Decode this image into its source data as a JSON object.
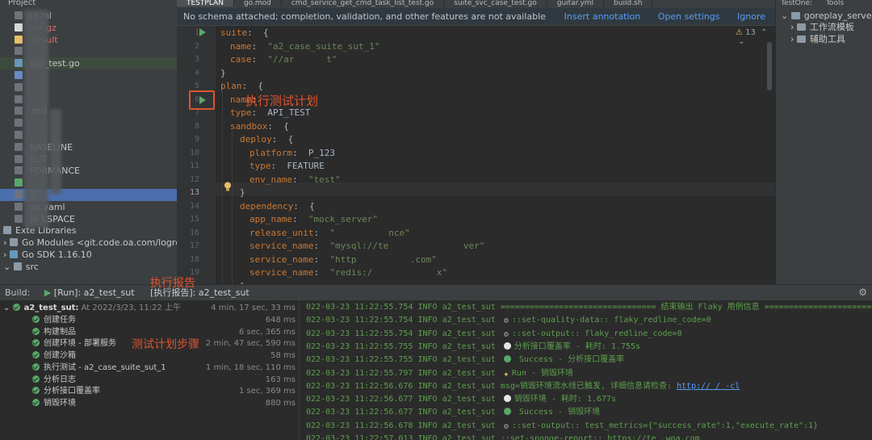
{
  "project": {
    "title": "Project",
    "items": [
      {
        "label": "pa     ml",
        "color": "#a9b7c6"
      },
      {
        "label": "         ser    gz",
        "color": "#e06c6c"
      },
      {
        "label": "           -result",
        "color": "#e06c6c"
      },
      {
        "label": "",
        "color": "#c8c8c8"
      },
      {
        "label": "        tup_test.go",
        "color": "#c8c8c8"
      },
      {
        "label": "",
        "color": "#c8c8c8"
      },
      {
        "label": "",
        "color": "#c8c8c8"
      },
      {
        "label": "",
        "color": "#c8c8c8"
      },
      {
        "label": "          .md",
        "color": "#c8c8c8"
      },
      {
        "label": "",
        "color": "#c8c8c8"
      },
      {
        "label": "",
        "color": "#c8c8c8"
      },
      {
        "label": "         BASELINE",
        "color": "#c8c8c8"
      },
      {
        "label": "         SUT",
        "color": "#c8c8c8"
      },
      {
        "label": "         FORMANCE",
        "color": "#c8c8c8"
      },
      {
        "label": "",
        "color": "#c8c8c8"
      },
      {
        "label": "        A",
        "color": "#c8c8c8"
      },
      {
        "label": "        go.yaml",
        "color": "#c8c8c8"
      },
      {
        "label": "  W    KSPACE",
        "color": "#c8c8c8"
      },
      {
        "label": "Exte   Libraries",
        "color": "#c8c8c8"
      },
      {
        "label": "Go Modules <git.code.oa.com/logreplay/",
        "color": "#c8c8c8"
      },
      {
        "label": "Go SDK 1.16.10",
        "color": "#c8c8c8"
      },
      {
        "label": "src",
        "color": "#c8c8c8"
      }
    ]
  },
  "editor": {
    "tabs": [
      "TESTPLAN",
      "go.mod",
      "cmd_service_get_cmd_task_list_test.go",
      "suite_svc_case_test.go",
      "guitar.yml",
      "build.sh"
    ],
    "banner": {
      "message": "No schema attached; completion, validation, and other features are not available",
      "insert": "Insert annotation",
      "settings": "Open settings",
      "ignore": "Ignore"
    },
    "warning_count": "13",
    "annotation": "执行测试计划",
    "lines": [
      {
        "n": "1",
        "indent": 0,
        "key": "suite",
        "val": "",
        "tail": "{"
      },
      {
        "n": "2",
        "indent": 1,
        "key": "name",
        "val": "\"a2_case_suite_sut_1\"",
        "tail": ""
      },
      {
        "n": "3",
        "indent": 1,
        "key": "case",
        "val": "\"//ar      t\"",
        "tail": ""
      },
      {
        "n": "4",
        "indent": 0,
        "key": "",
        "val": "",
        "tail": "}"
      },
      {
        "n": "5",
        "indent": 0,
        "key": "plan",
        "val": "",
        "tail": "{"
      },
      {
        "n": "6",
        "indent": 1,
        "key": "name",
        "val": "",
        "tail": ""
      },
      {
        "n": "7",
        "indent": 1,
        "key": "type",
        "val": "API_TEST",
        "tail": ""
      },
      {
        "n": "8",
        "indent": 1,
        "key": "sandbox",
        "val": "",
        "tail": "{"
      },
      {
        "n": "9",
        "indent": 2,
        "key": "deploy",
        "val": "",
        "tail": "{"
      },
      {
        "n": "10",
        "indent": 3,
        "key": "platform",
        "val": "P_123",
        "tail": ""
      },
      {
        "n": "11",
        "indent": 3,
        "key": "type",
        "val": "FEATURE",
        "tail": ""
      },
      {
        "n": "12",
        "indent": 3,
        "key": "env_name",
        "val": "\"test\"",
        "tail": ""
      },
      {
        "n": "13",
        "indent": 2,
        "key": "",
        "val": "",
        "tail": "}"
      },
      {
        "n": "14",
        "indent": 2,
        "key": "dependency",
        "val": "",
        "tail": "{"
      },
      {
        "n": "15",
        "indent": 3,
        "key": "app_name",
        "val": "\"mock_server\"",
        "tail": ""
      },
      {
        "n": "16",
        "indent": 3,
        "key": "release_unit",
        "val": "\"          nce\"",
        "tail": ""
      },
      {
        "n": "17",
        "indent": 3,
        "key": "service_name",
        "val": "\"mysql://te              ver\"",
        "tail": ""
      },
      {
        "n": "18",
        "indent": 3,
        "key": "service_name",
        "val": "\"http          .com\"",
        "tail": ""
      },
      {
        "n": "19",
        "indent": 3,
        "key": "service_name",
        "val": "\"redis:/            x\"",
        "tail": ""
      },
      {
        "n": "",
        "indent": 2,
        "key": "",
        "val": "",
        "tail": "}"
      }
    ]
  },
  "right_panel": {
    "tabs": [
      "TestOne:",
      "Tools"
    ],
    "root": "goreplay_server",
    "children": [
      "工作流模板",
      "辅助工具"
    ]
  },
  "build": {
    "label": "Build:",
    "tab_run": "[Run]: a2_test_sut",
    "tab_report": "[执行报告]: a2_test_sut",
    "annotation_report": "执行报告",
    "annotation_steps": "测试计划步骤",
    "root": {
      "name": "a2_test_sut:",
      "at": "At 2022/3/23, 11:22 上午",
      "time": "4 min, 17 sec, 33 ms"
    },
    "steps": [
      {
        "name": "创建任务",
        "time": "648 ms"
      },
      {
        "name": "构建制品",
        "time": "6 sec, 365 ms"
      },
      {
        "name": "创建环境 - 部署服务",
        "time": "2 min, 47 sec, 590 ms"
      },
      {
        "name": "创建沙箱",
        "time": "58 ms"
      },
      {
        "name": "执行测试 - a2_case_suite_sut_1",
        "time": "1 min, 18 sec, 110 ms"
      },
      {
        "name": "分析日志",
        "time": "163 ms"
      },
      {
        "name": "分析接口覆盖率",
        "time": "1 sec, 369 ms"
      },
      {
        "name": "销毁环境",
        "time": "880 ms"
      }
    ],
    "log": [
      {
        "ts": "022-03-23 11:22:55.754",
        "lvl": "INFO a2_test_sut",
        "icon": "",
        "msg": "================================ 结束输出 Flaky 用例信息 ================================"
      },
      {
        "ts": "022-03-23 11:22:55.754",
        "lvl": "INFO a2_test_sut",
        "icon": "gear",
        "msg": "::set-quality-data:: flaky_redline_code=0"
      },
      {
        "ts": "022-03-23 11:22:55.754",
        "lvl": "INFO a2_test_sut",
        "icon": "gear",
        "msg": "::set-output:: flaky_redline_code=0"
      },
      {
        "ts": "022-03-23 11:22:55.755",
        "lvl": "INFO a2_test_sut",
        "icon": "white",
        "msg": "分析接口覆盖率 - 耗时: 1.755s"
      },
      {
        "ts": "022-03-23 11:22:55.755",
        "lvl": "INFO a2_test_sut",
        "icon": "check",
        "msg": " Success - 分析接口覆盖率"
      },
      {
        "ts": "022-03-23 11:22:55.797",
        "lvl": "INFO a2_test_sut",
        "icon": "star",
        "msg": "Run - 销毁环境"
      },
      {
        "ts": "022-03-23 11:22:56.676",
        "lvl": "INFO a2_test_sut",
        "icon": "",
        "msg": "msg=销毁环境流水线已触发, 详细信息请检查: ",
        "link": "http://                  /                    -cl"
      },
      {
        "ts": "022-03-23 11:22:56.677",
        "lvl": "INFO a2_test_sut",
        "icon": "white",
        "msg": "销毁环境 - 耗时: 1.677s"
      },
      {
        "ts": "022-03-23 11:22:56.677",
        "lvl": "INFO a2_test_sut",
        "icon": "check",
        "msg": " Success - 销毁环境"
      },
      {
        "ts": "022-03-23 11:22:56.678",
        "lvl": "INFO a2_test_sut",
        "icon": "gear",
        "msg": "::set-output:: test_metrics={\"success_rate\":1,\"execute_rate\":1}"
      },
      {
        "ts": "022-03-23 11:22:57.013",
        "lvl": "INFO a2_test_sut",
        "icon": "",
        "msg": "::set-sponge-report:: https://te                          .woa.com"
      }
    ]
  },
  "colors": {
    "accent": "#e0532f",
    "link": "#589df6",
    "success": "#59a869"
  }
}
